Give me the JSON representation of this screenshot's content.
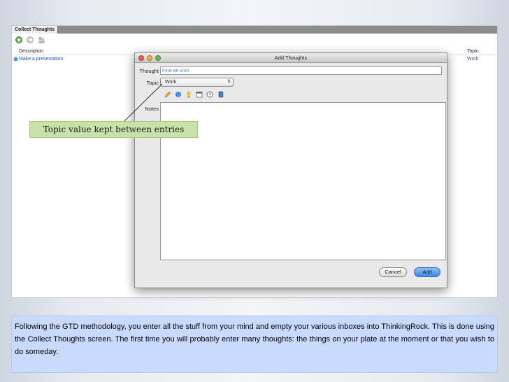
{
  "app": {
    "tab_title": "Collect Thoughts",
    "columns": {
      "description": "Description",
      "topic": "Topic"
    },
    "row": {
      "description": "Make a presentation",
      "topic": "Work"
    },
    "toolbar_icons": [
      "add-thought-icon",
      "process-icon",
      "people-icon"
    ]
  },
  "dialog": {
    "title": "Add Thoughts",
    "thought_label": "Thought",
    "thought_value": "Find an icon",
    "topic_label": "Topic",
    "topic_value": "Work",
    "notes_label": "Notes",
    "notes_value": "",
    "toolbar_icons": [
      "pencil-icon",
      "globe-icon",
      "lightbulb-icon",
      "calendar-icon",
      "clock-icon",
      "book-icon"
    ],
    "cancel_label": "Cancel",
    "add_label": "Add"
  },
  "callout": {
    "text": "Topic value kept between entries"
  },
  "caption": {
    "text": "Following the GTD methodology, you enter all the stuff from your mind and empty your various inboxes into ThinkingRock. This is done using the Collect Thoughts screen. The first time you will probably enter many thoughts: the things on your plate at the moment or that you wish to do someday."
  },
  "colors": {
    "link_blue": "#2a53c4",
    "callout_green": "#c7e3a9",
    "caption_blue": "#c8dbff",
    "add_button_blue": "#3a86e4"
  }
}
